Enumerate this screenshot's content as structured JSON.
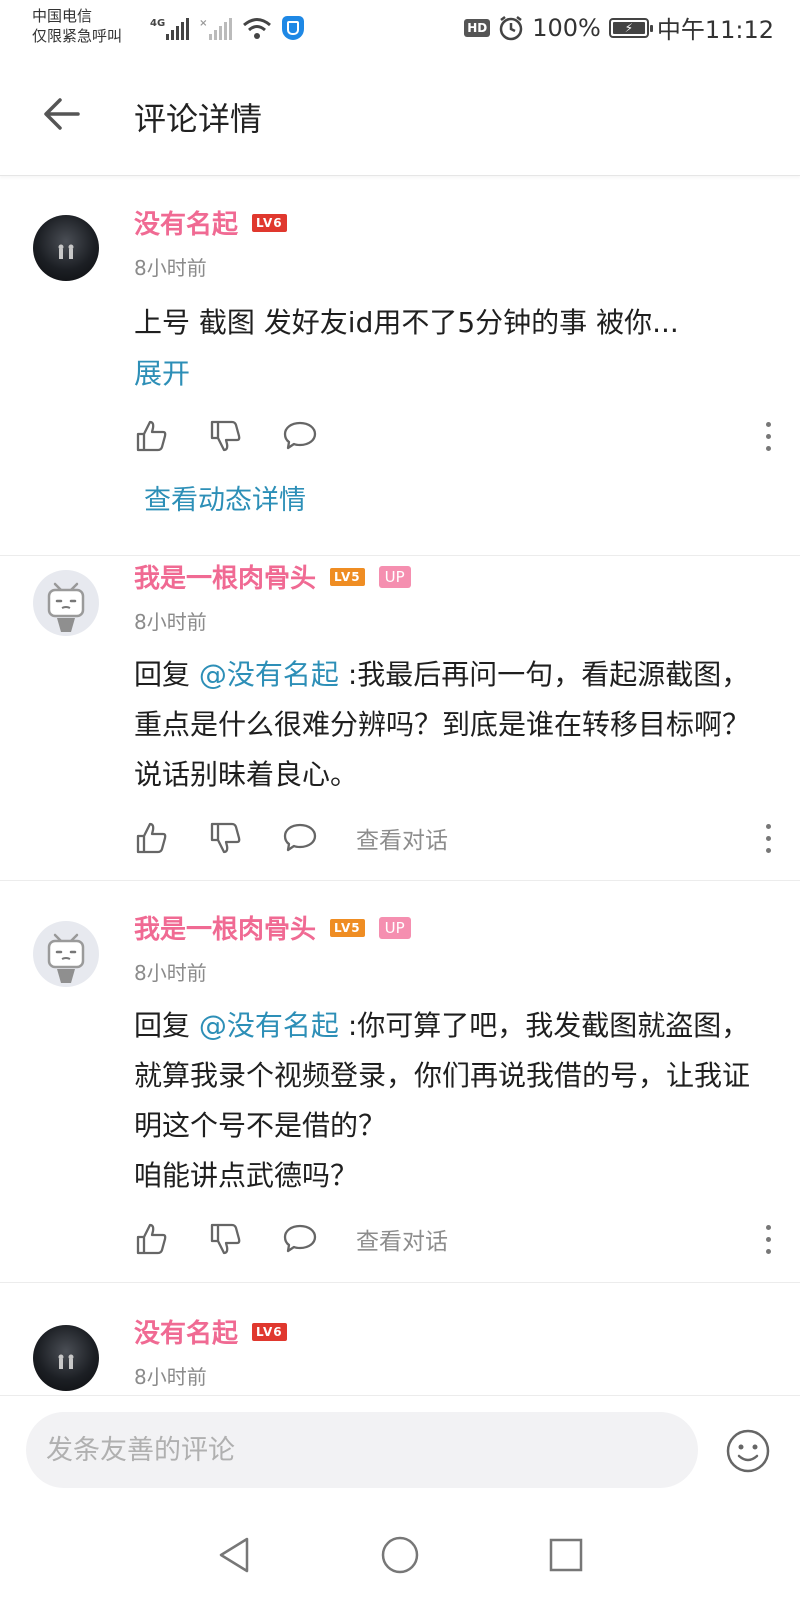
{
  "status_bar": {
    "carrier_line1": "中国电信",
    "carrier_line2": "仅限紧急呼叫",
    "network_tag": "4G",
    "hd": "HD",
    "battery": "100%",
    "time": "中午11:12"
  },
  "header": {
    "title": "评论详情"
  },
  "comments": [
    {
      "user": "没有名起",
      "level": "LV6",
      "time": "8小时前",
      "text": "上号 截图 发好友id用不了5分钟的事 被你...",
      "expand": "展开",
      "link": "查看动态详情"
    },
    {
      "user": "我是一根肉骨头",
      "level": "LV5",
      "badge": "UP",
      "time": "8小时前",
      "reply_prefix": "回复 ",
      "mention": "@没有名起",
      "text": " :我最后再问一句，看起源截图，重点是什么很难分辨吗？到底是谁在转移目标啊？说话别昧着良心。",
      "view_conversation": "查看对话"
    },
    {
      "user": "我是一根肉骨头",
      "level": "LV5",
      "badge": "UP",
      "time": "8小时前",
      "reply_prefix": "回复 ",
      "mention": "@没有名起",
      "text_line1": " :你可算了吧，我发截图就盗图，就算我录个视频登录，你们再说我借的号，让我证明这个号不是借的？",
      "text_line2": "咱能讲点武德吗？",
      "view_conversation": "查看对话"
    },
    {
      "user": "没有名起",
      "level": "LV6",
      "time": "8小时前"
    }
  ],
  "input": {
    "placeholder": "发条友善的评论"
  },
  "colors": {
    "username": "#f06a93",
    "link": "#2d8fb7",
    "lv6": "#e0382e",
    "lv5": "#ef8d23",
    "up_badge": "#f58fb0"
  },
  "icons": [
    "back-arrow-icon",
    "like-icon",
    "dislike-icon",
    "reply-icon",
    "more-icon",
    "emoji-icon",
    "nav-back-icon",
    "nav-home-icon",
    "nav-recent-icon"
  ]
}
